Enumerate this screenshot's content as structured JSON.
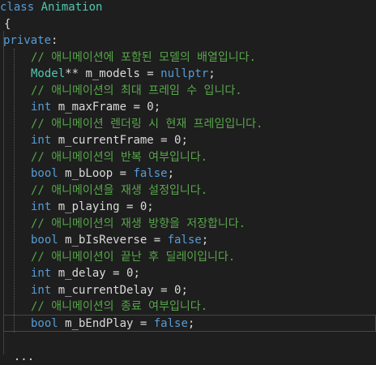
{
  "editor": {
    "lines": [
      {
        "id": "class-decl",
        "segments": [
          {
            "t": "class ",
            "c": "kw"
          },
          {
            "t": "Animation",
            "c": "type"
          }
        ]
      },
      {
        "id": "brace-open",
        "segments": [
          {
            "t": "{",
            "c": "pl"
          }
        ]
      },
      {
        "id": "access-private",
        "segments": [
          {
            "t": "private",
            "c": "kw"
          },
          {
            "t": ":",
            "c": "pl"
          }
        ]
      },
      {
        "id": "comment-models",
        "segments": [
          {
            "t": "// 애니메이션에 포함된 모델의 배열입니다.",
            "c": "cm"
          }
        ]
      },
      {
        "id": "decl-models",
        "segments": [
          {
            "t": "Model",
            "c": "type"
          },
          {
            "t": "** m_models = ",
            "c": "vr"
          },
          {
            "t": "nullptr",
            "c": "kw"
          },
          {
            "t": ";",
            "c": "pl"
          }
        ]
      },
      {
        "id": "comment-maxframe",
        "segments": [
          {
            "t": "// 애니메이션의 최대 프레임 수 입니다.",
            "c": "cm"
          }
        ]
      },
      {
        "id": "decl-maxframe",
        "segments": [
          {
            "t": "int",
            "c": "kw"
          },
          {
            "t": " m_maxFrame = 0;",
            "c": "vr"
          }
        ]
      },
      {
        "id": "comment-currentframe",
        "segments": [
          {
            "t": "// 애니메이션 렌더링 시 현재 프레임입니다.",
            "c": "cm"
          }
        ]
      },
      {
        "id": "decl-currentframe",
        "segments": [
          {
            "t": "int",
            "c": "kw"
          },
          {
            "t": " m_currentFrame = 0;",
            "c": "vr"
          }
        ]
      },
      {
        "id": "comment-loop",
        "segments": [
          {
            "t": "// 애니메이션의 반복 여부입니다.",
            "c": "cm"
          }
        ]
      },
      {
        "id": "decl-loop",
        "segments": [
          {
            "t": "bool",
            "c": "kw"
          },
          {
            "t": " m_bLoop = ",
            "c": "vr"
          },
          {
            "t": "false",
            "c": "kw"
          },
          {
            "t": ";",
            "c": "pl"
          }
        ]
      },
      {
        "id": "comment-playing",
        "segments": [
          {
            "t": "// 애니메이션을 재생 설정입니다.",
            "c": "cm"
          }
        ]
      },
      {
        "id": "decl-playing",
        "segments": [
          {
            "t": "int",
            "c": "kw"
          },
          {
            "t": " m_playing = 0;",
            "c": "vr"
          }
        ]
      },
      {
        "id": "comment-reverse",
        "segments": [
          {
            "t": "// 애니메이션의 재생 방향을 저장합니다.",
            "c": "cm"
          }
        ]
      },
      {
        "id": "decl-reverse",
        "segments": [
          {
            "t": "bool",
            "c": "kw"
          },
          {
            "t": " m_bIsReverse = ",
            "c": "vr"
          },
          {
            "t": "false",
            "c": "kw"
          },
          {
            "t": ";",
            "c": "pl"
          }
        ]
      },
      {
        "id": "comment-delay",
        "segments": [
          {
            "t": "// 애니메이션이 끝난 후 딜레이입니다.",
            "c": "cm"
          }
        ]
      },
      {
        "id": "decl-delay",
        "segments": [
          {
            "t": "int",
            "c": "kw"
          },
          {
            "t": " m_delay = 0;",
            "c": "vr"
          }
        ]
      },
      {
        "id": "decl-currentdelay",
        "segments": [
          {
            "t": "int",
            "c": "kw"
          },
          {
            "t": " m_currentDelay = 0;",
            "c": "vr"
          }
        ]
      },
      {
        "id": "comment-endplay",
        "segments": [
          {
            "t": "// 애니메이션의 종료 여부입니다.",
            "c": "cm"
          }
        ]
      },
      {
        "id": "decl-endplay",
        "segments": [
          {
            "t": "bool",
            "c": "kw"
          },
          {
            "t": " m_bEndPlay = ",
            "c": "vr"
          },
          {
            "t": "false",
            "c": "kw"
          },
          {
            "t": ";",
            "c": "pl"
          }
        ]
      },
      {
        "id": "blank",
        "segments": []
      },
      {
        "id": "partial-next",
        "segments": [
          {
            "t": "  ...",
            "c": "pl"
          }
        ]
      }
    ],
    "colors": {
      "background": "#1e1e1e",
      "keyword": "#569cd6",
      "type": "#4ec9b0",
      "comment": "#57a64a",
      "plain": "#dcdcdc"
    }
  }
}
